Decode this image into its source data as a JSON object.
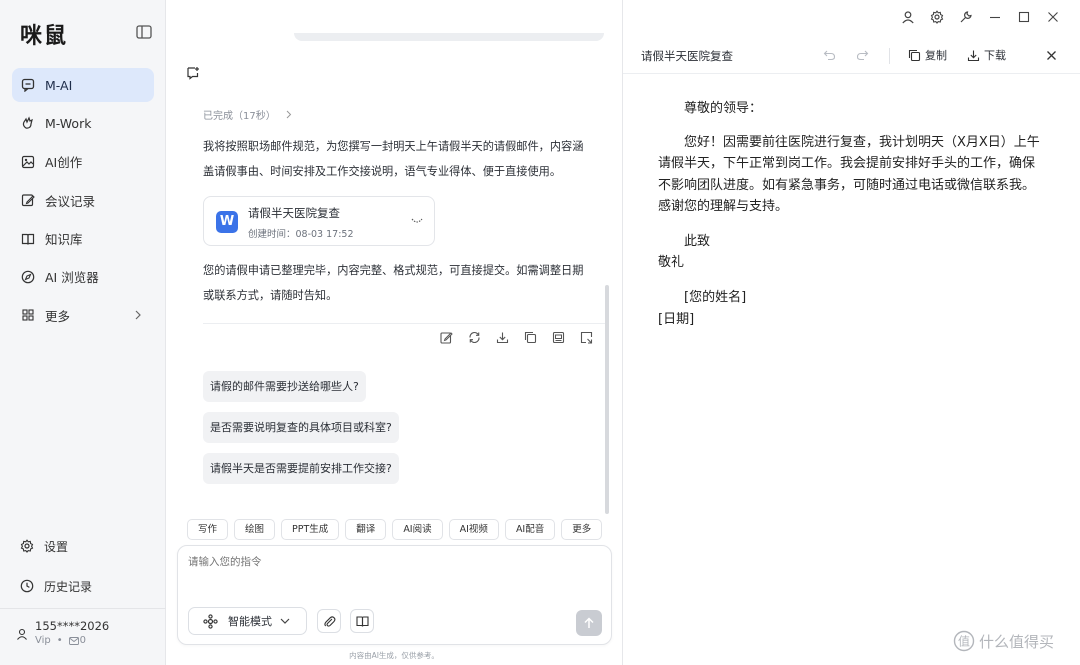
{
  "sidebar": {
    "logo": "咪鼠",
    "nav": [
      {
        "label": "M-AI",
        "icon": "chat-bubble-icon",
        "active": true
      },
      {
        "label": "M-Work",
        "icon": "hand-icon"
      },
      {
        "label": "AI创作",
        "icon": "image-icon"
      },
      {
        "label": "会议记录",
        "icon": "edit-note-icon"
      },
      {
        "label": "知识库",
        "icon": "book-icon"
      },
      {
        "label": "AI 浏览器",
        "icon": "compass-icon"
      },
      {
        "label": "更多",
        "icon": "grid-icon"
      }
    ],
    "settings_label": "设置",
    "history_label": "历史记录",
    "user": {
      "phone": "155****2026",
      "level": "Vip",
      "dot": "•",
      "count": "0"
    }
  },
  "chat": {
    "status": "已完成（17秒）",
    "intro": [
      "我将按照职场邮件规范，为您撰写一封明天上午请假半天的请假邮件，内容涵",
      "盖请假事由、时间安排及工作交接说明，语气专业得体、便于直接使用。"
    ],
    "file": {
      "badge": "W",
      "name": "请假半天医院复查",
      "time": "创建时间：08-03 17:52"
    },
    "summary": [
      "您的请假申请已整理完毕，内容完整、格式规范，可直接提交。如需调整日期",
      "或联系方式，请随时告知。"
    ],
    "suggestions": [
      "请假的邮件需要抄送给哪些人?",
      "是否需要说明复查的具体项目或科室?",
      "请假半天是否需要提前安排工作交接?"
    ],
    "tools": [
      "写作",
      "绘图",
      "PPT生成",
      "翻译",
      "AI阅读",
      "AI视频",
      "AI配音",
      "更多"
    ],
    "input_placeholder": "请输入您的指令",
    "mode_label": "智能模式",
    "disclaimer": "内容由AI生成，仅供参考。"
  },
  "doc": {
    "title": "请假半天医院复查",
    "copy_label": "复制",
    "download_label": "下载",
    "salutation": "尊敬的领导：",
    "body": [
      "您好！因需要前往医院进行复查，我计划明天（X月X日）上午",
      "请假半天，下午正常到岗工作。我会提前安排好手头的工作，确保",
      "不影响团队进度。如有紧急事务，可随时通过电话或微信联系我。",
      "感谢您的理解与支持。"
    ],
    "closing1": "此致",
    "closing2": "敬礼",
    "name_placeholder": "[您的姓名]",
    "date_placeholder": "[日期]"
  },
  "watermark": "什么值得买",
  "colors": {
    "accent": "#3b73e8",
    "active_bg": "#dde8fb",
    "sidebar_bg": "#f5f6f8"
  }
}
